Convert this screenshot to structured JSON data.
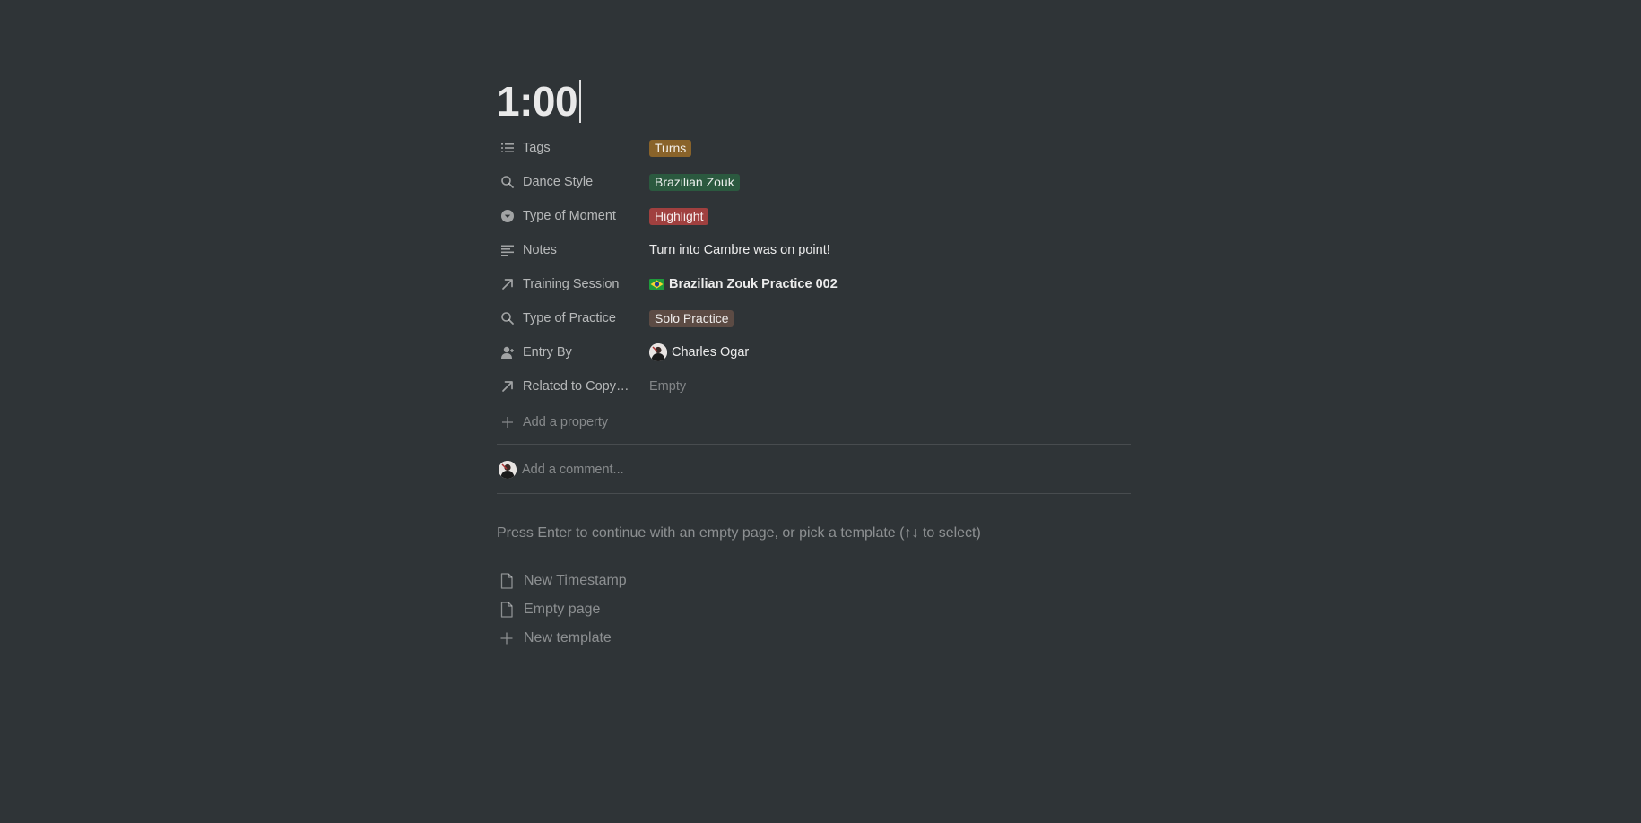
{
  "page": {
    "title": "1:00"
  },
  "properties": [
    {
      "name": "Tags",
      "icon": "list-icon",
      "type": "tag",
      "value": "Turns",
      "color": "#89632a"
    },
    {
      "name": "Dance Style",
      "icon": "search-icon",
      "type": "tag",
      "value": "Brazilian Zouk",
      "color": "#2b593f"
    },
    {
      "name": "Type of Moment",
      "icon": "dropdown-circle-icon",
      "type": "tag",
      "value": "Highlight",
      "color": "#a0403f"
    },
    {
      "name": "Notes",
      "icon": "text-lines-icon",
      "type": "text",
      "value": "Turn into Cambre was on point!"
    },
    {
      "name": "Training Session",
      "icon": "arrow-up-right-icon",
      "type": "relation",
      "value": "Brazilian Zouk Practice 002",
      "flag": "brazil-flag-icon"
    },
    {
      "name": "Type of Practice",
      "icon": "search-icon",
      "type": "tag",
      "value": "Solo Practice",
      "color": "#5c4b44"
    },
    {
      "name": "Entry By",
      "icon": "person-icon",
      "type": "person",
      "value": "Charles Ogar"
    },
    {
      "name": "Related to Copy ...",
      "icon": "arrow-up-right-icon",
      "type": "empty",
      "value": "Empty"
    }
  ],
  "add_property_label": "Add a property",
  "comment": {
    "placeholder": "Add a comment..."
  },
  "hint_text": "Press Enter to continue with an empty page, or pick a template (↑↓ to select)",
  "templates": [
    {
      "label": "New Timestamp",
      "icon": "page-icon"
    },
    {
      "label": "Empty page",
      "icon": "page-icon"
    },
    {
      "label": "New template",
      "icon": "plus-icon"
    }
  ],
  "colors": {
    "background": "#2f3437",
    "tag_turns": "#89632a",
    "tag_brazilian_zouk": "#2b593f",
    "tag_highlight": "#a0403f",
    "tag_solo_practice": "#5c4b44"
  }
}
